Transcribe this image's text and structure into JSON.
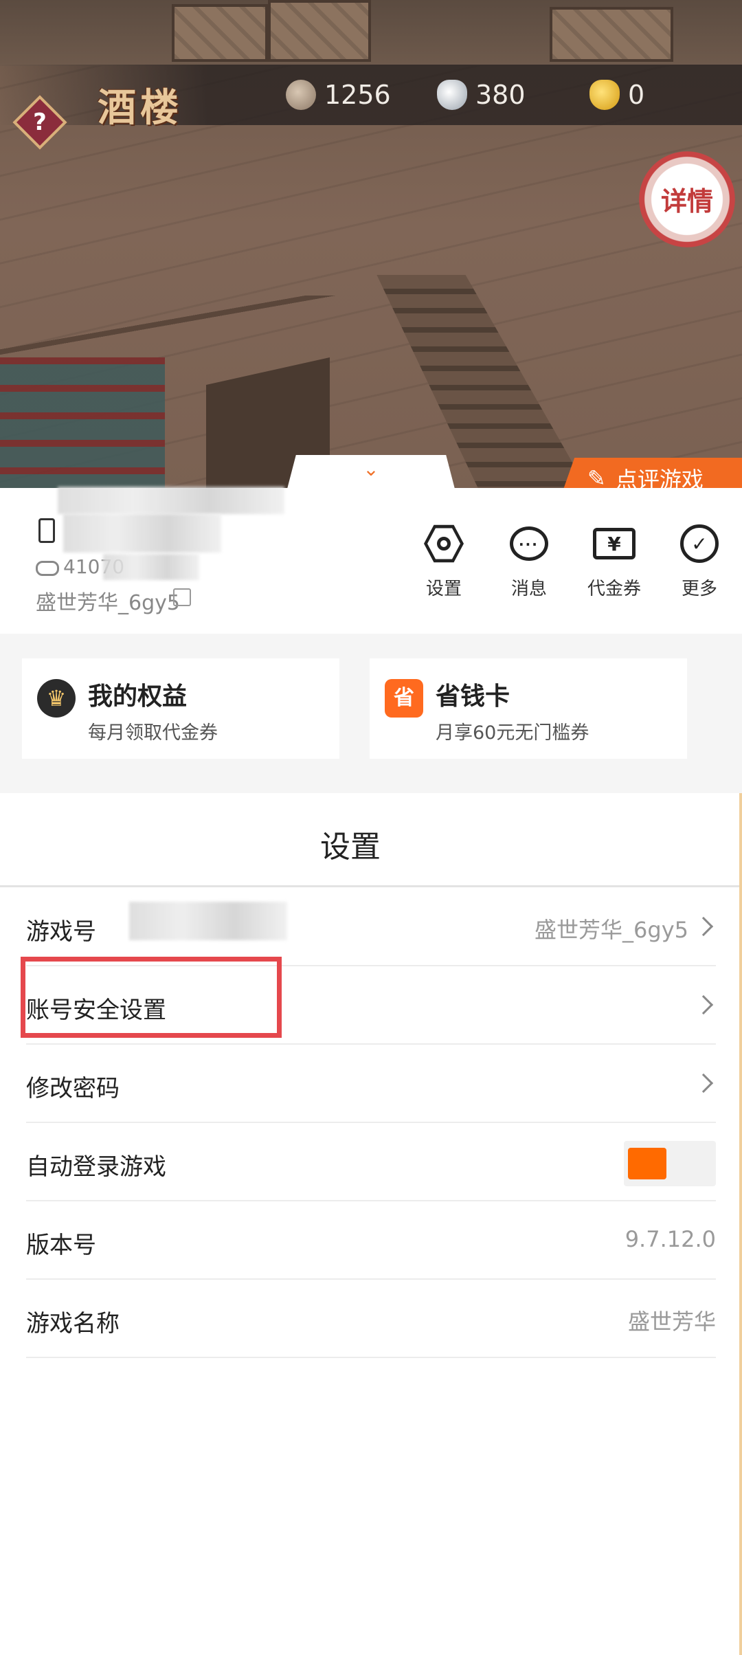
{
  "scene": {
    "title": "酒楼",
    "help_label": "?",
    "resources": [
      {
        "icon": "copper-coin-icon",
        "value": "1256"
      },
      {
        "icon": "silver-ingot-icon",
        "value": "380"
      },
      {
        "icon": "gold-ingot-icon",
        "value": "0"
      }
    ],
    "detail_label": "详情"
  },
  "review_button": {
    "label": "点评游戏"
  },
  "account": {
    "id_partial": "41070",
    "name": "盛世芳华_6gy5"
  },
  "quick_actions": [
    {
      "icon": "settings-hex-icon",
      "label": "设置"
    },
    {
      "icon": "message-bubble-icon",
      "label": "消息"
    },
    {
      "icon": "voucher-ticket-icon",
      "label": "代金券"
    },
    {
      "icon": "more-circle-icon",
      "label": "更多"
    }
  ],
  "promos": [
    {
      "icon": "crown-icon",
      "title": "我的权益",
      "subtitle": "每月领取代金券"
    },
    {
      "icon": "save-card-icon",
      "icon_text": "省",
      "title": "省钱卡",
      "subtitle": "月享60元无门槛券"
    }
  ],
  "settings": {
    "title": "设置",
    "rows": [
      {
        "label": "游戏号",
        "value": "盛世芳华_6gy5",
        "chevron": true
      },
      {
        "label": "账号安全设置",
        "value": "",
        "chevron": true
      },
      {
        "label": "修改密码",
        "value": "",
        "chevron": true
      },
      {
        "label": "自动登录游戏",
        "toggle": true,
        "toggle_on": true
      },
      {
        "label": "版本号",
        "value": "9.7.12.0"
      },
      {
        "label": "游戏名称",
        "value": "盛世芳华"
      }
    ]
  },
  "colors": {
    "accent": "#f26a21",
    "highlight": "#e5484d",
    "toggle": "#ff6a00"
  }
}
